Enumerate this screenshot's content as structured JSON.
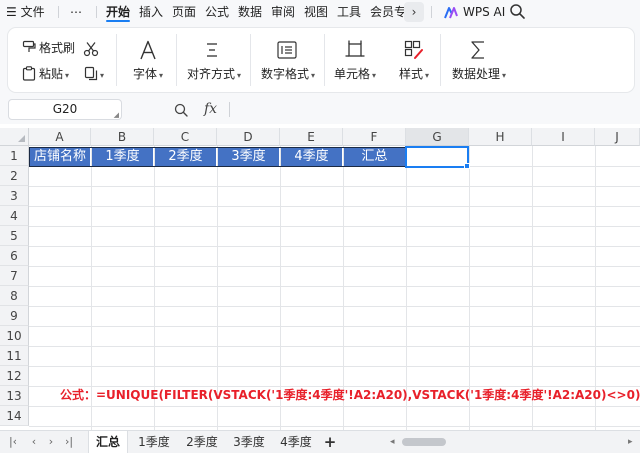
{
  "menubar": {
    "file_label": "文件",
    "more_label": "⋯",
    "tabs": [
      "开始",
      "插入",
      "页面",
      "公式",
      "数据",
      "审阅",
      "视图",
      "工具",
      "会员专"
    ],
    "active_tab": "开始",
    "chevron": "›",
    "wps_ai_label": "WPS AI"
  },
  "ribbon": {
    "format_painter": "格式刷",
    "paste": "粘贴",
    "font": "字体",
    "align": "对齐方式",
    "number_format": "数字格式",
    "cell": "单元格",
    "style": "样式",
    "data_process": "数据处理"
  },
  "formula_bar": {
    "cell_ref": "G20",
    "fx": "fx",
    "formula": ""
  },
  "grid": {
    "columns": [
      "A",
      "B",
      "C",
      "D",
      "E",
      "F",
      "G",
      "H",
      "I",
      "J"
    ],
    "rows": [
      "1",
      "2",
      "3",
      "4",
      "5",
      "6",
      "7",
      "8",
      "9",
      "10",
      "11",
      "12",
      "13",
      "14"
    ],
    "header_cells": [
      "店铺名称",
      "1季度",
      "2季度",
      "3季度",
      "4季度",
      "汇总"
    ],
    "header_fill": "#4472c4",
    "note": "公式：=UNIQUE(FILTER(VSTACK('1季度:4季度'!A2:A20),VSTACK('1季度:4季度'!A2:A20)<>0))",
    "note_color": "#e8202a"
  },
  "sheet_tabs": {
    "tabs": [
      "汇总",
      "1季度",
      "2季度",
      "3季度",
      "4季度"
    ],
    "active": "汇总",
    "add_label": "+"
  }
}
